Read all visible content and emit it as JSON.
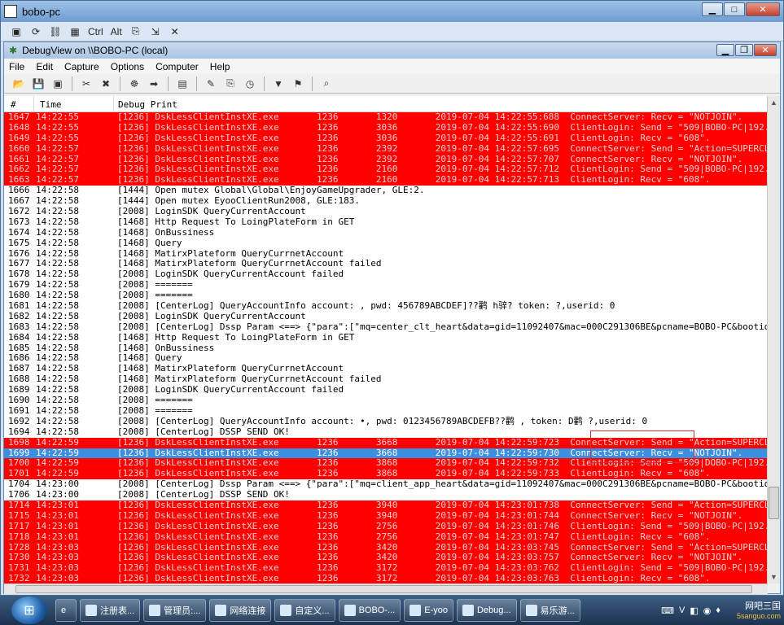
{
  "outer_window": {
    "title": "bobo-pc",
    "toolbar": [
      "▣",
      "⟳",
      "⛓",
      "▦",
      "Ctrl",
      "Alt",
      "⎘",
      "⇲",
      "✕"
    ]
  },
  "inner_window": {
    "title": "DebugView on \\\\BOBO-PC (local)"
  },
  "menu": [
    "File",
    "Edit",
    "Capture",
    "Options",
    "Computer",
    "Help"
  ],
  "columns": {
    "num": "#",
    "time": "Time",
    "debug": "Debug Print"
  },
  "rows": [
    {
      "n": "1647",
      "t": "14:22:55",
      "d": "[1236] DskLessClientInstXE.exe       1236       1320       2019-07-04 14:22:55:688  ConnectServer: Recv = \"NOTJOIN\".",
      "s": "red"
    },
    {
      "n": "1648",
      "t": "14:22:55",
      "d": "[1236] DskLessClientInstXE.exe       1236       3036       2019-07-04 14:22:55:690  ClientLogin: Send = \"509|BOBO-PC|192.168.122...",
      "s": "red"
    },
    {
      "n": "1649",
      "t": "14:22:55",
      "d": "[1236] DskLessClientInstXE.exe       1236       3036       2019-07-04 14:22:55:691  ClientLogin: Recv = \"608\".",
      "s": "red"
    },
    {
      "n": "1660",
      "t": "14:22:57",
      "d": "[1236] DskLessClientInstXE.exe       1236       2392       2019-07-04 14:22:57:695  ConnectServer: Send = \"Action=SUPERCLIENT_GET...",
      "s": "red"
    },
    {
      "n": "1661",
      "t": "14:22:57",
      "d": "[1236] DskLessClientInstXE.exe       1236       2392       2019-07-04 14:22:57:707  ConnectServer: Recv = \"NOTJOIN\".",
      "s": "red"
    },
    {
      "n": "1662",
      "t": "14:22:57",
      "d": "[1236] DskLessClientInstXE.exe       1236       2160       2019-07-04 14:22:57:712  ClientLogin: Send = \"509|BOBO-PC|192.168.122...",
      "s": "red"
    },
    {
      "n": "1663",
      "t": "14:22:57",
      "d": "[1236] DskLessClientInstXE.exe       1236       2160       2019-07-04 14:22:57:713  ClientLogin: Recv = \"608\".",
      "s": "red"
    },
    {
      "n": "1666",
      "t": "14:22:58",
      "d": "[1444] Open mutex Global\\Global\\EnjoyGameUpgrader, GLE:2.",
      "s": "white"
    },
    {
      "n": "1667",
      "t": "14:22:58",
      "d": "[1444] Open mutex EyooClientRun2008, GLE:183.",
      "s": "white"
    },
    {
      "n": "1672",
      "t": "14:22:58",
      "d": "[2008] LoginSDK QueryCurrentAccount",
      "s": "white"
    },
    {
      "n": "1673",
      "t": "14:22:58",
      "d": "[1468] Http Request To LoingPlateForm in GET",
      "s": "white"
    },
    {
      "n": "1674",
      "t": "14:22:58",
      "d": "[1468] OnBussiness",
      "s": "white"
    },
    {
      "n": "1675",
      "t": "14:22:58",
      "d": "[1468] Query",
      "s": "white"
    },
    {
      "n": "1676",
      "t": "14:22:58",
      "d": "[1468] MatirxPlateform QueryCurrnetAccount",
      "s": "white"
    },
    {
      "n": "1677",
      "t": "14:22:58",
      "d": "[1468] MatirxPlateform QueryCurrnetAccount failed",
      "s": "white"
    },
    {
      "n": "1678",
      "t": "14:22:58",
      "d": "[2008] LoginSDK QueryCurrentAccount failed",
      "s": "white"
    },
    {
      "n": "1679",
      "t": "14:22:58",
      "d": "[2008] =======",
      "s": "white"
    },
    {
      "n": "1680",
      "t": "14:22:58",
      "d": "[2008] =======",
      "s": "white"
    },
    {
      "n": "1681",
      "t": "14:22:58",
      "d": "[2008] [CenterLog] QueryAccountInfo account: , pwd: 456789ABCDEF]??鹳 h骍? token: ?,userid: 0",
      "s": "white"
    },
    {
      "n": "1682",
      "t": "14:22:58",
      "d": "[2008] LoginSDK QueryCurrentAccount",
      "s": "white"
    },
    {
      "n": "1683",
      "t": "14:22:58",
      "d": "[2008] [CenterLog] Dssp Param <==> {\"para\":[\"mq=center_clt_heart&data=gid=11092407&mac=000C291306BE&pcname=BOBO-PC&bootid=..",
      "s": "white"
    },
    {
      "n": "1684",
      "t": "14:22:58",
      "d": "[1468] Http Request To LoingPlateForm in GET",
      "s": "white"
    },
    {
      "n": "1685",
      "t": "14:22:58",
      "d": "[1468] OnBussiness",
      "s": "white"
    },
    {
      "n": "1686",
      "t": "14:22:58",
      "d": "[1468] Query",
      "s": "white"
    },
    {
      "n": "1687",
      "t": "14:22:58",
      "d": "[1468] MatirxPlateform QueryCurrnetAccount",
      "s": "white"
    },
    {
      "n": "1688",
      "t": "14:22:58",
      "d": "[1468] MatirxPlateform QueryCurrnetAccount failed",
      "s": "white"
    },
    {
      "n": "1689",
      "t": "14:22:58",
      "d": "[2008] LoginSDK QueryCurrentAccount failed",
      "s": "white"
    },
    {
      "n": "1690",
      "t": "14:22:58",
      "d": "[2008] =======",
      "s": "white"
    },
    {
      "n": "1691",
      "t": "14:22:58",
      "d": "[2008] =======",
      "s": "white"
    },
    {
      "n": "1692",
      "t": "14:22:58",
      "d": "[2008] [CenterLog] QueryAccountInfo account: •, pwd: 0123456789ABCDEFB??鹳 , token: D鹳 ?,userid: 0",
      "s": "white"
    },
    {
      "n": "1694",
      "t": "14:22:58",
      "d": "[2008] [CenterLog] DSSP SEND OK!",
      "s": "white"
    },
    {
      "n": "1698",
      "t": "14:22:59",
      "d": "[1236] DskLessClientInstXE.exe       1236       3668       2019-07-04 14:22:59:723  ConnectServer: Send = \"Action=SUPERCLIENT_GET...",
      "s": "red"
    },
    {
      "n": "1699",
      "t": "14:22:59",
      "d": "[1236] DskLessClientInstXE.exe       1236       3668       2019-07-04 14:22:59:730  ConnectServer: Recv = \"NOTJOIN\".",
      "s": "blue"
    },
    {
      "n": "1700",
      "t": "14:22:59",
      "d": "[1236] DskLessClientInstXE.exe       1236       3868       2019-07-04 14:22:59:732  ClientLogin: Send = \"509|DOBO-PC|192.168.122...",
      "s": "red"
    },
    {
      "n": "1701",
      "t": "14:22:59",
      "d": "[1236] DskLessClientInstXE.exe       1236       3868       2019-07-04 14:22:59:733  ClientLogin: Recv = \"608\".",
      "s": "red"
    },
    {
      "n": "1704",
      "t": "14:23:00",
      "d": "[2008] [CenterLog] Dssp Param <==> {\"para\":[\"mq=client_app_heart&data=gid=11092407&mac=000C291306BE&pcname=BOBO-PC&bootid=..",
      "s": "white"
    },
    {
      "n": "1706",
      "t": "14:23:00",
      "d": "[2008] [CenterLog] DSSP SEND OK!",
      "s": "white"
    },
    {
      "n": "1714",
      "t": "14:23:01",
      "d": "[1236] DskLessClientInstXE.exe       1236       3940       2019-07-04 14:23:01:738  ConnectServer: Send = \"Action=SUPERCLIENT_GET...",
      "s": "red"
    },
    {
      "n": "1715",
      "t": "14:23:01",
      "d": "[1236] DskLessClientInstXE.exe       1236       3940       2019-07-04 14:23:01:744  ConnectServer: Recv = \"NOTJOIN\".",
      "s": "red"
    },
    {
      "n": "1717",
      "t": "14:23:01",
      "d": "[1236] DskLessClientInstXE.exe       1236       2756       2019-07-04 14:23:01:746  ClientLogin: Send = \"509|BOBO-PC|192.168.122...",
      "s": "red"
    },
    {
      "n": "1718",
      "t": "14:23:01",
      "d": "[1236] DskLessClientInstXE.exe       1236       2756       2019-07-04 14:23:01:747  ClientLogin: Recv = \"608\".",
      "s": "red"
    },
    {
      "n": "1728",
      "t": "14:23:03",
      "d": "[1236] DskLessClientInstXE.exe       1236       3420       2019-07-04 14:23:03:745  ConnectServer: Send = \"Action=SUPERCLIENT_GET...",
      "s": "red"
    },
    {
      "n": "1730",
      "t": "14:23:03",
      "d": "[1236] DskLessClientInstXE.exe       1236       3420       2019-07-04 14:23:03:757  ConnectServer: Recv = \"NOTJOIN\".",
      "s": "red"
    },
    {
      "n": "1731",
      "t": "14:23:03",
      "d": "[1236] DskLessClientInstXE.exe       1236       3172       2019-07-04 14:23:03:762  ClientLogin: Send = \"509|BOBO-PC|192.168.122...",
      "s": "red"
    },
    {
      "n": "1732",
      "t": "14:23:03",
      "d": "[1236] DskLessClientInstXE.exe       1236       3172       2019-07-04 14:23:03:763  ClientLogin: Recv = \"608\".",
      "s": "red"
    }
  ],
  "taskbar": {
    "items": [
      "注册表...",
      "管理员:...",
      "网络连接",
      "自定义...",
      "BOBO-...",
      "E-yoo",
      "Debug...",
      "易乐游..."
    ],
    "tray": [
      "⌨",
      "V",
      "◧",
      "◉",
      "♦"
    ]
  },
  "watermark": "网吧三国",
  "watermark_sub": "5sanguo.com",
  "colors": {
    "highlight_red": "#ff0000",
    "selected_blue": "#3a8fe0"
  }
}
